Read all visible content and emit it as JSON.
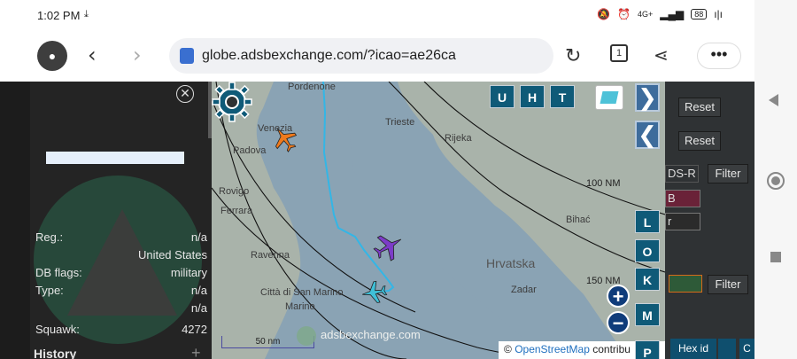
{
  "status_bar": {
    "time": "1:02 PM",
    "download_glyph": "⤓",
    "right_icons": [
      "mute-icon",
      "alarm-icon",
      "signal-icon",
      "wifi-icon"
    ],
    "network": "4G+",
    "battery": "88"
  },
  "browser": {
    "url": "globe.adsbexchange.com/?icao=ae26ca",
    "tab_count": "1",
    "menu_label": "•••"
  },
  "info_panel": {
    "close_glyph": "✕",
    "rows": [
      {
        "key": "Reg.:",
        "value": "n/a"
      },
      {
        "key": "",
        "value": "United States"
      },
      {
        "key": "DB flags:",
        "value": "military"
      },
      {
        "key": "Type:",
        "value": "n/a"
      },
      {
        "key": "",
        "value": "n/a"
      },
      {
        "key": "Squawk:",
        "value": "4272"
      }
    ],
    "history_label": "History",
    "history_plus": "+"
  },
  "map": {
    "places": [
      {
        "name": "Venezia",
        "big": false
      },
      {
        "name": "Padova",
        "big": false
      },
      {
        "name": "Rovigo",
        "big": false
      },
      {
        "name": "Ferrara",
        "big": false
      },
      {
        "name": "Ravenna",
        "big": false
      },
      {
        "name": "Trieste",
        "big": false
      },
      {
        "name": "Rijeka",
        "big": false
      },
      {
        "name": "Bihać",
        "big": false
      },
      {
        "name": "Hrvatska",
        "big": true
      },
      {
        "name": "Zadar",
        "big": false
      },
      {
        "name": "Città di San Marino",
        "big": false
      },
      {
        "name": "Pordenone",
        "big": false
      }
    ],
    "range_labels": [
      "100 NM",
      "150 NM"
    ],
    "scale_label": "50 nm",
    "watermark": "adsbexchange.com",
    "attribution_prefix": "© ",
    "attribution_link": "OpenStreetMap",
    "attribution_suffix": " contribu",
    "top_buttons": [
      "U",
      "H",
      "T"
    ],
    "side_buttons": [
      "L",
      "O",
      "K",
      "M",
      "P"
    ],
    "zoom_in": "+",
    "zoom_out": "−",
    "arrow_right": "❯",
    "arrow_left": "❮",
    "aircraft_colors": {
      "orange": "#f07a1c",
      "purple": "#7c3cc8",
      "cyan": "#3fc0d8",
      "track": "#33b6e6"
    }
  },
  "right_panel": {
    "reset_1": "Reset",
    "reset_2": "Reset",
    "filter_1": "Filter",
    "filter_2": "Filter",
    "ds_label": "DS-R",
    "field_b": "B",
    "field_r": "r",
    "hex_id": "Hex id",
    "col_c": "C"
  }
}
